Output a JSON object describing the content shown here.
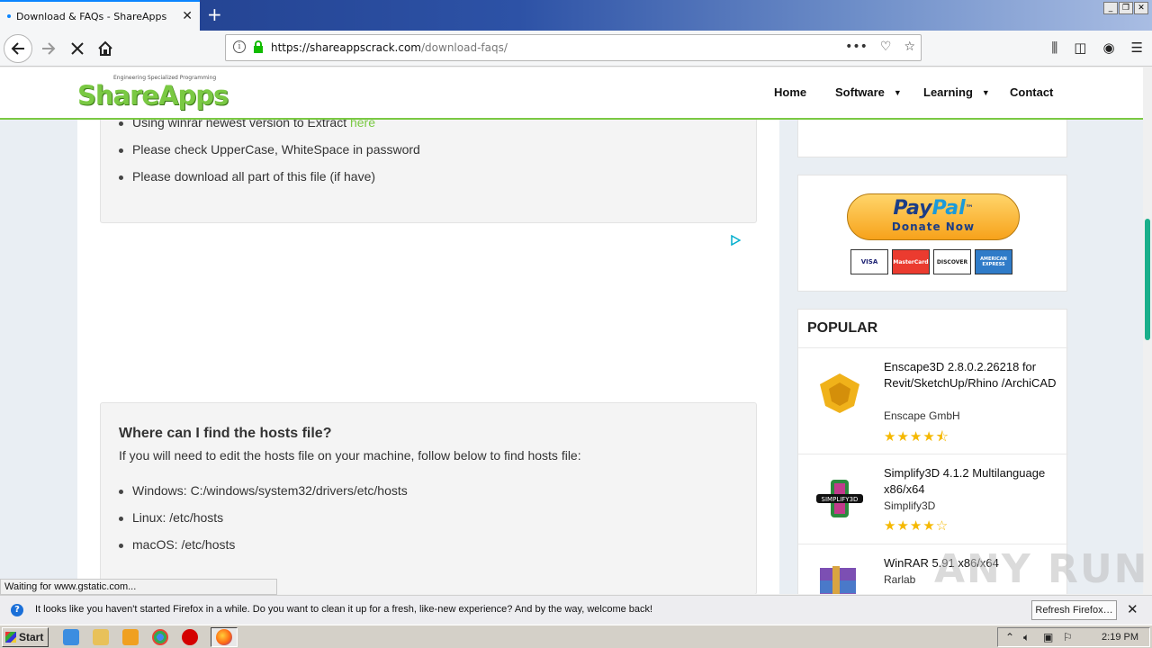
{
  "browser": {
    "tab_title": "Download & FAQs - ShareAppsCra",
    "new_tab": "+",
    "url_host": "https://shareappscrack.com",
    "url_path": "/download-faqs/",
    "status_text": "Waiting for www.gstatic.com..."
  },
  "site": {
    "logo_text": "ShareApps",
    "logo_tagline": "Engineering Specialized Programming",
    "menu": [
      {
        "label": "Home"
      },
      {
        "label": "Software"
      },
      {
        "label": "Learning"
      },
      {
        "label": "Contact"
      }
    ]
  },
  "main": {
    "faq1_items": [
      {
        "text": "Using winrar newest version to Extract ",
        "link": "here"
      },
      {
        "text": "Please check UpperCase, WhiteSpace in password"
      },
      {
        "text": "Please download all part of this file (if have)"
      }
    ],
    "hosts_title": "Where can I find the hosts file?",
    "hosts_intro": "If you will need to edit the hosts file on your machine, follow below to find hosts file:",
    "hosts_items": [
      "Windows: C:/windows/system32/drivers/etc/hosts",
      "Linux: /etc/hosts",
      "macOS: /etc/hosts"
    ]
  },
  "sidebar": {
    "paypal": {
      "pay": "Pay",
      "pal": "Pal",
      "tm": "™",
      "donate": "Donate Now"
    },
    "cards": [
      "VISA",
      "MasterCard",
      "DISCOVER",
      "AMERICAN EXPRESS"
    ],
    "popular_title": "POPULAR",
    "popular": [
      {
        "name": "Enscape3D 2.8.0.2.26218 for Revit/SketchUp/Rhino /ArchiCAD",
        "vendor": "Enscape GmbH",
        "rating": 4.5,
        "stars": "★★★★⯪"
      },
      {
        "name": "Simplify3D 4.1.2 Multilanguage x86/x64",
        "vendor": "Simplify3D",
        "rating": 4,
        "stars": "★★★★☆"
      },
      {
        "name": "WinRAR 5.91 x86/x64",
        "vendor": "Rarlab"
      }
    ]
  },
  "notification": {
    "message": "It looks like you haven't started Firefox in a while. Do you want to clean it up for a fresh, like-new experience? And by the way, welcome back!",
    "button": "Refresh Firefox…"
  },
  "taskbar": {
    "start": "Start",
    "time": "2:19 PM"
  },
  "watermark": "ANY RUN",
  "colors": {
    "brand_green": "#7ac943",
    "firefox_blue": "#0a84ff"
  }
}
